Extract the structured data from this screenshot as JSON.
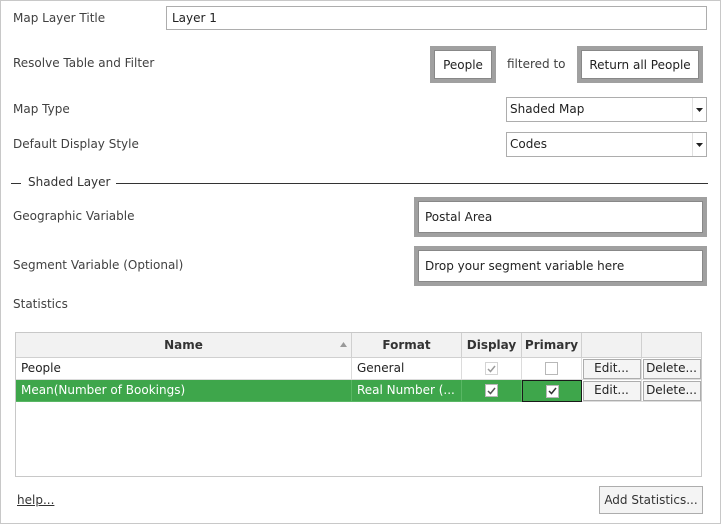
{
  "form": {
    "map_layer_title_label": "Map Layer Title",
    "map_layer_title_value": "Layer 1",
    "resolve_label": "Resolve Table and Filter",
    "resolve_table": "People",
    "filtered_to": "filtered to",
    "resolve_filter": "Return all People",
    "map_type_label": "Map Type",
    "map_type_value": "Shaded Map",
    "display_style_label": "Default Display Style",
    "display_style_value": "Codes"
  },
  "shaded_layer": {
    "section_title": "Shaded Layer",
    "geographic_label": "Geographic Variable",
    "geographic_value": "Postal Area",
    "segment_label": "Segment Variable (Optional)",
    "segment_placeholder": "Drop your segment variable here",
    "statistics_label": "Statistics"
  },
  "grid": {
    "columns": [
      "Name",
      "Format",
      "Display",
      "Primary"
    ],
    "rows": [
      {
        "name": "People",
        "format": "General",
        "display": true,
        "display_enabled": false,
        "primary": false,
        "edit": "Edit...",
        "delete": "Delete...",
        "selected": false
      },
      {
        "name": "Mean(Number of Bookings)",
        "format": "Real Number (...",
        "display": true,
        "display_enabled": false,
        "primary": true,
        "edit": "Edit...",
        "delete": "Delete...",
        "selected": true
      }
    ]
  },
  "footer": {
    "help": "help...",
    "add_statistics": "Add Statistics..."
  },
  "colors": {
    "selection": "#3ea64b",
    "drop_well": "#a0a0a0"
  }
}
